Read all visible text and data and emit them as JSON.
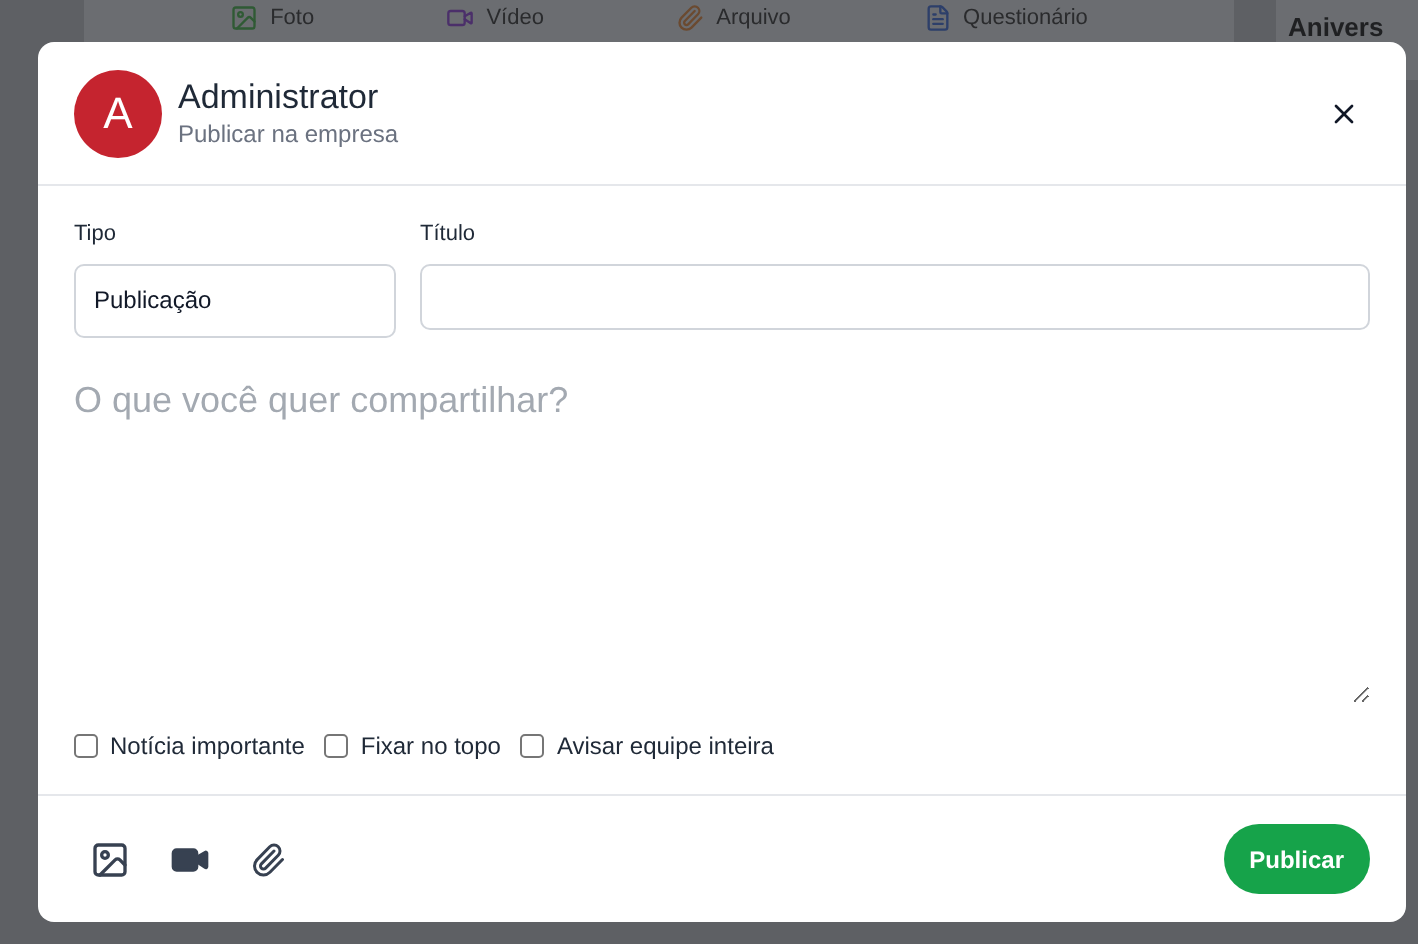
{
  "background": {
    "post_actions": [
      {
        "kind": "photo",
        "label": "Foto"
      },
      {
        "kind": "video",
        "label": "Vídeo"
      },
      {
        "kind": "file",
        "label": "Arquivo"
      },
      {
        "kind": "survey",
        "label": "Questionário"
      }
    ],
    "side_title": "Anivers"
  },
  "dialog": {
    "avatar_letter": "A",
    "author": "Administrator",
    "subtitle": "Publicar na empresa",
    "type_field": {
      "label": "Tipo",
      "value": "Publicação"
    },
    "title_field": {
      "label": "Título"
    },
    "message": {
      "placeholder": "O que você quer compartilhar?"
    },
    "options": [
      {
        "label": "Notícia importante",
        "checked": false
      },
      {
        "label": "Fixar no topo",
        "checked": false
      },
      {
        "label": "Avisar equipe inteira",
        "checked": false
      }
    ],
    "attachments": [
      {
        "kind": "image"
      },
      {
        "kind": "video"
      },
      {
        "kind": "file"
      }
    ],
    "submit": "Publicar"
  }
}
